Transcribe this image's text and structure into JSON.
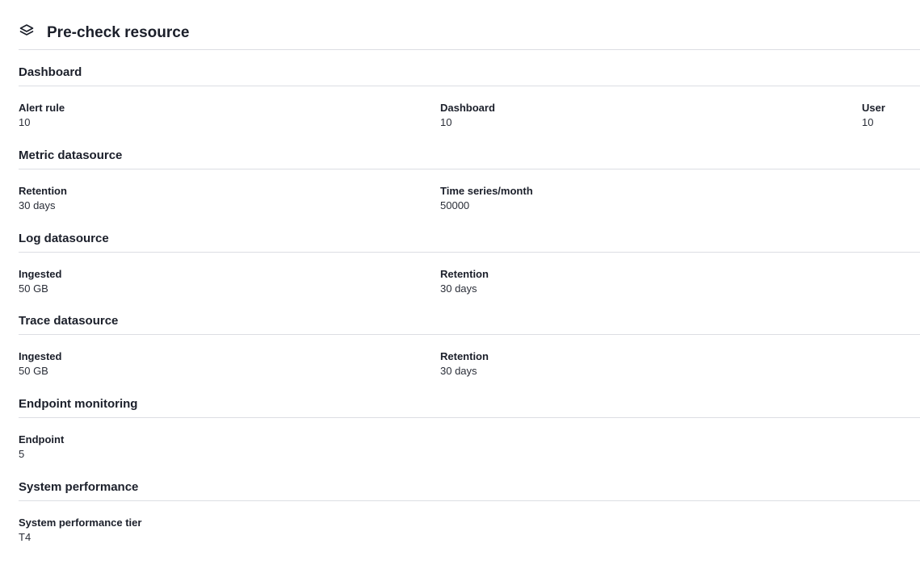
{
  "header": {
    "title": "Pre-check resource",
    "icon": "layers-icon"
  },
  "sections": [
    {
      "title": "Dashboard",
      "items": [
        {
          "label": "Alert rule",
          "value": "10"
        },
        {
          "label": "Dashboard",
          "value": "10"
        },
        {
          "label": "User",
          "value": "10"
        }
      ]
    },
    {
      "title": "Metric datasource",
      "items": [
        {
          "label": "Retention",
          "value": "30 days"
        },
        {
          "label": "Time series/month",
          "value": "50000"
        }
      ]
    },
    {
      "title": "Log datasource",
      "items": [
        {
          "label": "Ingested",
          "value": "50 GB"
        },
        {
          "label": "Retention",
          "value": "30 days"
        }
      ]
    },
    {
      "title": "Trace datasource",
      "items": [
        {
          "label": "Ingested",
          "value": "50 GB"
        },
        {
          "label": "Retention",
          "value": "30 days"
        }
      ]
    },
    {
      "title": "Endpoint monitoring",
      "items": [
        {
          "label": "Endpoint",
          "value": "5"
        }
      ]
    },
    {
      "title": "System performance",
      "items": [
        {
          "label": "System performance tier",
          "value": "T4"
        }
      ]
    }
  ]
}
